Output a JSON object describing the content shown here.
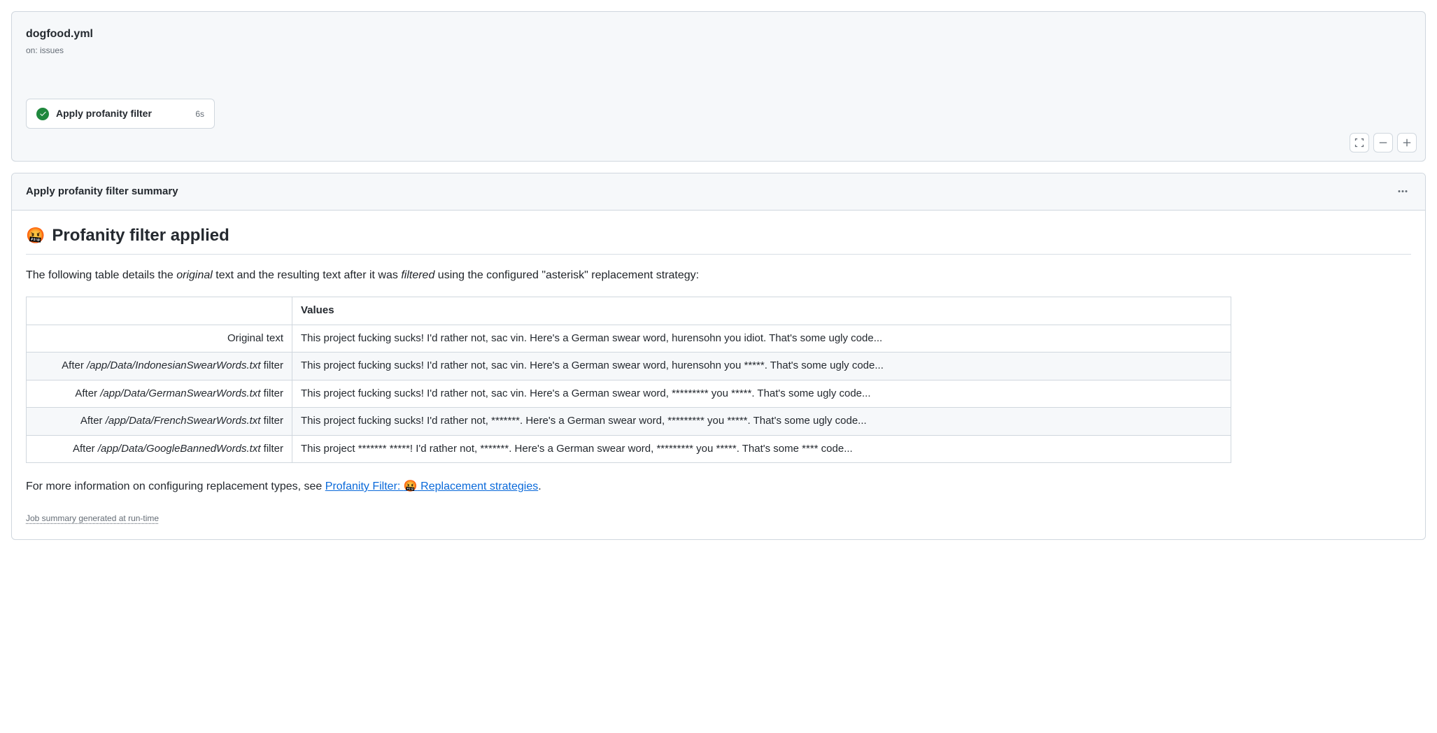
{
  "workflow": {
    "title": "dogfood.yml",
    "trigger": "on: issues",
    "job": {
      "name": "Apply profanity filter",
      "duration": "6s"
    }
  },
  "summary": {
    "header_title": "Apply profanity filter summary",
    "report_emoji": "🤬",
    "report_title": "Profanity filter applied",
    "description_parts": {
      "pre1": "The following table details the ",
      "em1": "original",
      "mid1": " text and the resulting text after it was ",
      "em2": "filtered",
      "post1": " using the configured \"asterisk\" replacement strategy:"
    },
    "table": {
      "header": "Values",
      "rows": [
        {
          "label_prefix": "",
          "label_path": "",
          "label_suffix": "Original text",
          "value": "This project fucking sucks! I'd rather not, sac vin. Here's a German swear word, hurensohn you idiot. That's some ugly code..."
        },
        {
          "label_prefix": "After ",
          "label_path": "/app/Data/IndonesianSwearWords.txt",
          "label_suffix": " filter",
          "value": "This project fucking sucks! I'd rather not, sac vin. Here's a German swear word, hurensohn you *****. That's some ugly code..."
        },
        {
          "label_prefix": "After ",
          "label_path": "/app/Data/GermanSwearWords.txt",
          "label_suffix": " filter",
          "value": "This project fucking sucks! I'd rather not, sac vin. Here's a German swear word, ********* you *****. That's some ugly code..."
        },
        {
          "label_prefix": "After ",
          "label_path": "/app/Data/FrenchSwearWords.txt",
          "label_suffix": " filter",
          "value": "This project fucking sucks! I'd rather not, *******. Here's a German swear word, ********* you *****. That's some ugly code..."
        },
        {
          "label_prefix": "After ",
          "label_path": "/app/Data/GoogleBannedWords.txt",
          "label_suffix": " filter",
          "value": "This project ******* *****! I'd rather not, *******. Here's a German swear word, ********* you *****. That's some **** code..."
        }
      ]
    },
    "more_info": {
      "prefix": "For more information on configuring replacement types, see ",
      "link_text_pre": "Profanity Filter: ",
      "link_emoji": "🤬",
      "link_text_post": " Replacement strategies",
      "suffix": "."
    },
    "footer_note": "Job summary generated at run-time"
  }
}
